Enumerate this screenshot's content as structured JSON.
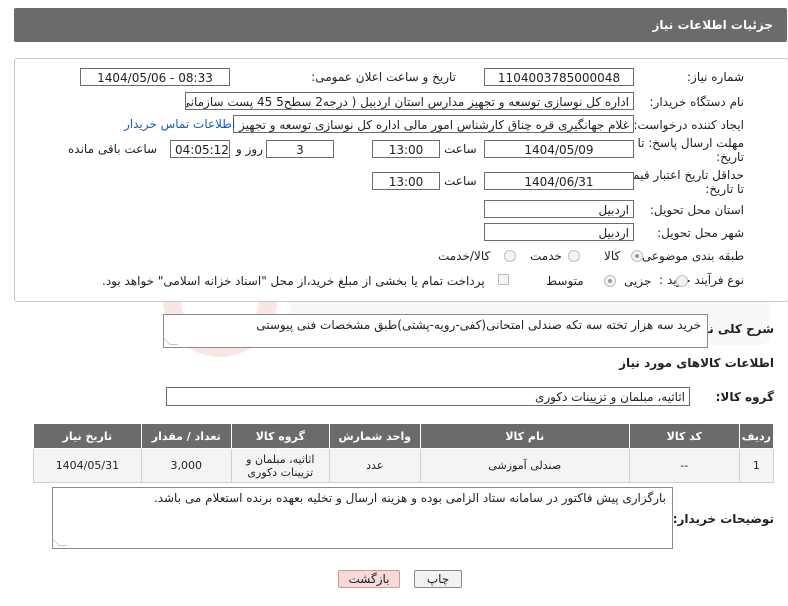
{
  "header": {
    "title": "جزئیات اطلاعات نیاز"
  },
  "form": {
    "need_number_label": "شماره نیاز:",
    "need_number": "1104003785000048",
    "announce_label": "تاریخ و ساعت اعلان عمومی:",
    "announce_value": "1404/05/06 - 08:33",
    "buyer_org_label": "نام دستگاه خریدار:",
    "buyer_org": "اداره کل نوسازی   توسعه و تجهیز مدارس استان اردبیل ( درجه2  سطح5  45 پست سازمانی",
    "creator_label": "ایجاد کننده درخواست:",
    "creator": "غلام جهانگیری قره چناق کارشناس امور مالی اداره کل نوسازی   توسعه و تجهیز مدارس",
    "contact_link": "اطلاعات تماس خریدار",
    "deadline_label_1": "مهلت ارسال پاسخ: تا",
    "deadline_label_2": "تاریخ:",
    "deadline_date": "1404/05/09",
    "time_label": "ساعت",
    "deadline_time": "13:00",
    "days_value": "3",
    "days_label": "روز و",
    "remaining_time": "04:05:12",
    "remaining_label": "ساعت باقی مانده",
    "price_label_1": "حداقل تاریخ اعتبار قیمت:",
    "price_label_2": "تا تاریخ:",
    "price_date": "1404/06/31",
    "price_time": "13:00",
    "province_label": "استان محل تحویل:",
    "province": "اردبیل",
    "city_label": "شهر محل تحویل:",
    "city": "اردبیل",
    "category_label": "طبقه بندی موضوعی:",
    "category_options": [
      "کالا",
      "خدمت",
      "کالا/خدمت"
    ],
    "process_label": "نوع فرآیند خرید :",
    "process_options": [
      "جزیی",
      "متوسط"
    ],
    "payment_note": "پرداخت تمام یا بخشی از مبلغ خرید،از محل \"اسناد خزانه اسلامی\" خواهد بود."
  },
  "summary": {
    "label": "شرح کلی نیاز:",
    "text": "خرید سه هزار تخته سه تکه صندلی امتحانی(کفی-رویه-پشتی)طبق مشخصات فنی پیوستی"
  },
  "goods_section": {
    "title": "اطلاعات کالاهای مورد نیاز",
    "group_label": "گروه کالا:",
    "group_value": "اثاثیه، مبلمان و تزیینات دکوری"
  },
  "table": {
    "headers": [
      "ردیف",
      "کد کالا",
      "نام کالا",
      "واحد شمارش",
      "گروه کالا",
      "تعداد / مقدار",
      "تاریخ نیاز"
    ],
    "rows": [
      [
        "1",
        "--",
        "صندلی آموزشی",
        "عدد",
        "اثاثیه، مبلمان و تزیینات دکوری",
        "3,000",
        "1404/05/31"
      ]
    ]
  },
  "buyer_notes": {
    "label": "توضیحات خریدار:",
    "text": "بارگزاری پیش فاکتور در سامانه ستاد الزامی بوده و هزینه ارسال و تخلیه بعهده برنده استعلام می باشد."
  },
  "buttons": {
    "print": "چاپ",
    "back": "بازگشت"
  },
  "colors": {
    "header_bg": "#6b6b6b",
    "link": "#1a5fb4",
    "back_button_bg": "#f7d9d9"
  }
}
